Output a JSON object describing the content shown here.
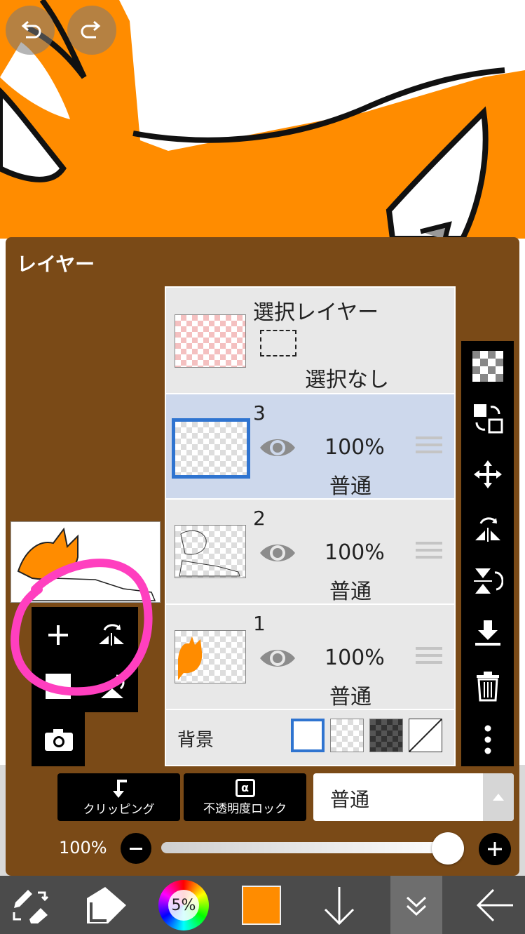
{
  "panel": {
    "title": "レイヤー"
  },
  "selection_layer": {
    "title": "選択レイヤー",
    "status": "選択なし"
  },
  "layers": [
    {
      "number": "3",
      "opacity": "100%",
      "blend": "普通",
      "selected": true
    },
    {
      "number": "2",
      "opacity": "100%",
      "blend": "普通",
      "selected": false
    },
    {
      "number": "1",
      "opacity": "100%",
      "blend": "普通",
      "selected": false
    }
  ],
  "background": {
    "label": "背景"
  },
  "actions": {
    "clipping": "クリッピング",
    "alpha_lock": "不透明度ロック",
    "alpha_symbol": "α"
  },
  "blend_select": {
    "value": "普通"
  },
  "opacity": {
    "value": "100%",
    "fraction": 0.95
  },
  "brush": {
    "size": "5%"
  },
  "colors": {
    "accent": "#ff8c00",
    "panel": "#7a4a17",
    "selected_row": "#cdd8ec",
    "highlight": "#ff3fbf",
    "selection_border": "#2f74d0"
  },
  "icons": [
    "undo-icon",
    "redo-icon",
    "checker-icon",
    "transform-icon",
    "move-icon",
    "flip-horizontal-icon",
    "flip-vertical-icon",
    "merge-down-icon",
    "trash-icon",
    "more-icon",
    "plus-icon",
    "camera-icon",
    "color-wheel-icon",
    "arrow-down-icon",
    "chevron-down-icon",
    "back-arrow-icon"
  ]
}
